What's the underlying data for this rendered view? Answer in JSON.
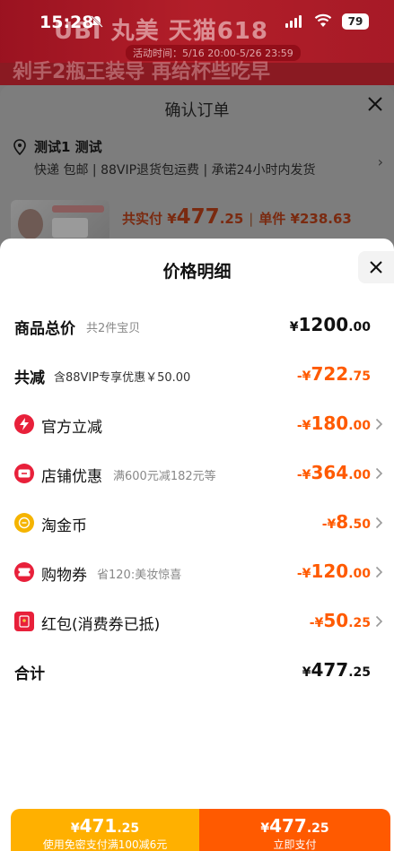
{
  "status_bar": {
    "time": "15:28",
    "battery": "79"
  },
  "background": {
    "banner_text": "UBI 丸美  天猫618",
    "banner_sub": "活动时间：5/16 20:00-5/26 23:59",
    "line2": "剁手2瓶王装导 再给杯些吃早"
  },
  "confirm_order": {
    "title": "确认订单",
    "address_name": "测试1 测试",
    "address_info": "快递 包邮 | 88VIP退货包运费 | 承诺24小时内发货",
    "paid_label": "共实付 ¥",
    "paid_int": "477",
    "paid_dec": ".25",
    "unit_label": "单件 ¥238.63"
  },
  "price_detail": {
    "title": "价格明细",
    "rows": [
      {
        "label": "商品总价",
        "sub": "共2件宝贝",
        "cur": "¥",
        "int": "1200",
        "dec": ".00"
      },
      {
        "label": "共减",
        "sub": "含88VIP专享优惠￥50.00",
        "cur": "-¥",
        "int": "722",
        "dec": ".75"
      },
      {
        "label": "官方立减",
        "sub": "",
        "cur": "-¥",
        "int": "180",
        "dec": ".00",
        "icon": "lightning-icon"
      },
      {
        "label": "店铺优惠",
        "sub": "满600元减182元等",
        "cur": "-¥",
        "int": "364",
        "dec": ".00",
        "icon": "store-coupon-icon"
      },
      {
        "label": "淘金币",
        "sub": "",
        "cur": "-¥",
        "int": "8",
        "dec": ".50",
        "icon": "gold-coin-icon"
      },
      {
        "label": "购物券",
        "sub": "省120:美妆惊喜",
        "cur": "-¥",
        "int": "120",
        "dec": ".00",
        "icon": "shopping-voucher-icon"
      },
      {
        "label": "红包(消费券已抵)",
        "sub": "",
        "cur": "-¥",
        "int": "50",
        "dec": ".25",
        "icon": "red-envelope-icon"
      },
      {
        "label": "合计",
        "sub": "",
        "cur": "¥",
        "int": "477",
        "dec": ".25"
      }
    ]
  },
  "bottom_bar": {
    "left_cur": "¥",
    "left_int": "471",
    "left_dec": ".25",
    "left_note": "使用免密支付满100减6元",
    "right_cur": "¥",
    "right_int": "477",
    "right_dec": ".25",
    "right_note": "立即支付"
  },
  "colors": {
    "accent": "#ff5a00",
    "secondary": "#ffb000",
    "icon_red": "#e8203a",
    "coin": "#f5b400"
  }
}
